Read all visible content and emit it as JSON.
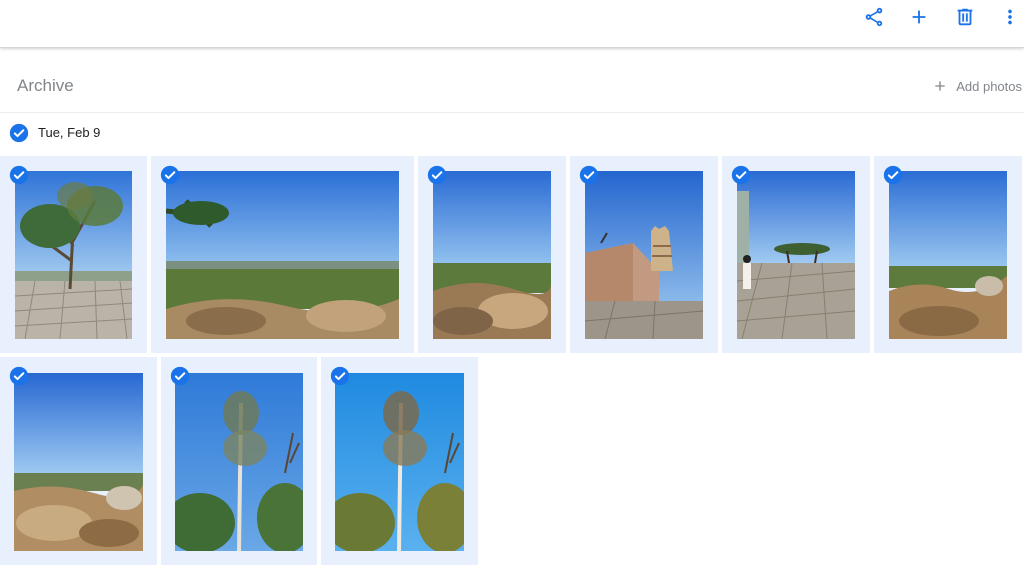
{
  "toolbar": {
    "actions": [
      "share-icon",
      "add-icon",
      "delete-icon",
      "more-vert-icon"
    ],
    "accent_color": "#1a73e8"
  },
  "header": {
    "title": "Archive",
    "add_photos_label": "Add photos"
  },
  "group": {
    "date": "Tue, Feb 9",
    "selected": true
  },
  "photos": [
    {
      "id": 1,
      "subject": "tree on stone terrace",
      "selected": true
    },
    {
      "id": 2,
      "subject": "panoramic forest valley view",
      "selected": true
    },
    {
      "id": 3,
      "subject": "valley view with rocks",
      "selected": true
    },
    {
      "id": 4,
      "subject": "temple gopuram and wall",
      "selected": true
    },
    {
      "id": 5,
      "subject": "stone courtyard with visitors",
      "selected": true
    },
    {
      "id": 6,
      "subject": "hill rocks and valley",
      "selected": true
    },
    {
      "id": 7,
      "subject": "rocky hilltop and sky",
      "selected": true
    },
    {
      "id": 8,
      "subject": "tall tree against sky",
      "selected": true
    },
    {
      "id": 9,
      "subject": "tall tree against sky",
      "selected": true
    }
  ]
}
